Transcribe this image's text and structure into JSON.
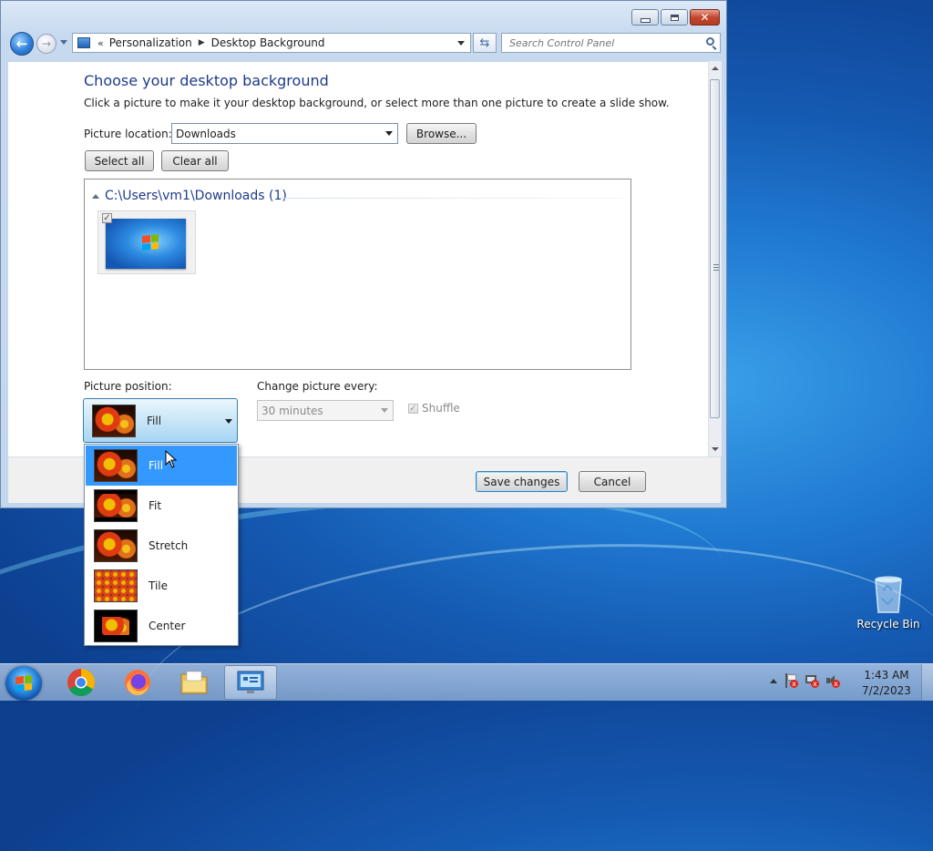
{
  "window": {
    "address": {
      "separator": "«",
      "crumbs": [
        "Personalization",
        "Desktop Background"
      ]
    },
    "search_placeholder": "Search Control Panel"
  },
  "main": {
    "title": "Choose your desktop background",
    "description": "Click a picture to make it your desktop background, or select more than one picture to create a slide show.",
    "picture_location_label": "Picture location:",
    "picture_location_value": "Downloads",
    "browse_label": "Browse...",
    "select_all_label": "Select all",
    "clear_all_label": "Clear all",
    "gallery": {
      "group_title": "C:\\Users\\vm1\\Downloads (1)",
      "items": [
        {
          "checked": true
        }
      ]
    },
    "picture_position_label": "Picture position:",
    "picture_position_value": "Fill",
    "change_picture_label": "Change picture every:",
    "change_picture_value": "30 minutes",
    "shuffle_label": "Shuffle",
    "shuffle_checked": true
  },
  "position_dropdown": {
    "options": [
      "Fill",
      "Fit",
      "Stretch",
      "Tile",
      "Center"
    ],
    "selected": "Fill"
  },
  "footer": {
    "save_label": "Save changes",
    "cancel_label": "Cancel"
  },
  "desktop": {
    "recycle_bin_label": "Recycle Bin"
  },
  "taskbar": {
    "pinned": [
      "start-button",
      "chrome-icon",
      "firefox-icon",
      "explorer-icon",
      "control-panel-icon"
    ],
    "time": "1:43 AM",
    "date": "7/2/2023"
  },
  "colors": {
    "title_blue": "#1e3b8a",
    "selection_blue": "#3399ff"
  }
}
